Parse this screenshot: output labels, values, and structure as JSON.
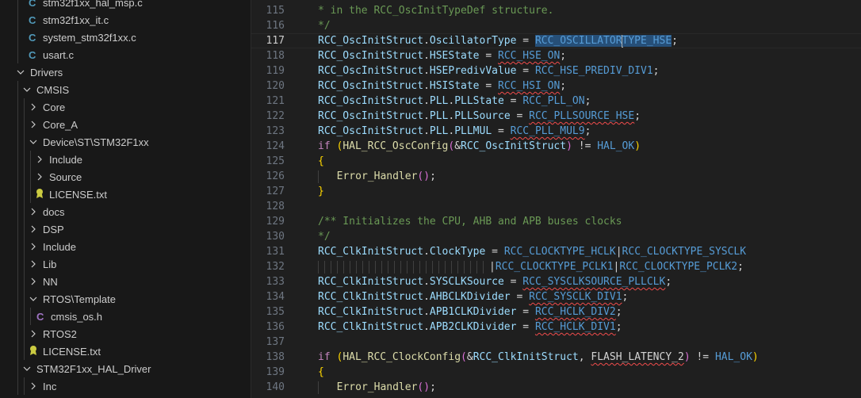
{
  "explorer": {
    "items": [
      {
        "label": "stm32f1xx_hal_msp.c",
        "type": "c-file"
      },
      {
        "label": "stm32f1xx_it.c",
        "type": "c-file"
      },
      {
        "label": "system_stm32f1xx.c",
        "type": "c-file"
      },
      {
        "label": "usart.c",
        "type": "c-file"
      },
      {
        "label": "Drivers",
        "type": "folder-open"
      },
      {
        "label": "CMSIS",
        "type": "folder-open"
      },
      {
        "label": "Core",
        "type": "folder"
      },
      {
        "label": "Core_A",
        "type": "folder"
      },
      {
        "label": "Device\\ST\\STM32F1xx",
        "type": "folder-open"
      },
      {
        "label": "Include",
        "type": "folder"
      },
      {
        "label": "Source",
        "type": "folder"
      },
      {
        "label": "LICENSE.txt",
        "type": "license-file"
      },
      {
        "label": "docs",
        "type": "folder"
      },
      {
        "label": "DSP",
        "type": "folder"
      },
      {
        "label": "Include",
        "type": "folder"
      },
      {
        "label": "Lib",
        "type": "folder"
      },
      {
        "label": "NN",
        "type": "folder"
      },
      {
        "label": "RTOS\\Template",
        "type": "folder-open"
      },
      {
        "label": "cmsis_os.h",
        "type": "c-file"
      },
      {
        "label": "RTOS2",
        "type": "folder"
      },
      {
        "label": "LICENSE.txt",
        "type": "license-file"
      },
      {
        "label": "STM32F1xx_HAL_Driver",
        "type": "folder-open"
      },
      {
        "label": "Inc",
        "type": "folder"
      }
    ]
  },
  "editor": {
    "active_line": "117",
    "line_numbers": [
      "115",
      "116",
      "117",
      "118",
      "119",
      "120",
      "121",
      "122",
      "123",
      "124",
      "125",
      "126",
      "127",
      "128",
      "129",
      "130",
      "131",
      "132",
      "133",
      "134",
      "135",
      "136",
      "137",
      "138",
      "139",
      "140"
    ],
    "code": {
      "l115": "* in the RCC_OscInitTypeDef structure.",
      "l116": "*/",
      "l117_a": "RCC_OscInitStruct",
      "l117_b": "OscillatorType",
      "l117_c": "RCC_OSCILLATOR",
      "l117_d": "TYPE_HSE",
      "l118_a": "RCC_OscInitStruct",
      "l118_b": "HSEState",
      "l118_c": "RCC_HSE_ON",
      "l119_a": "RCC_OscInitStruct",
      "l119_b": "HSEPredivValue",
      "l119_c": "RCC_HSE_PREDIV_DIV1",
      "l120_a": "RCC_OscInitStruct",
      "l120_b": "HSIState",
      "l120_c": "RCC_HSI_ON",
      "l121_a": "RCC_OscInitStruct",
      "l121_b": "PLL",
      "l121_c": "PLLState",
      "l121_d": "RCC_PLL_ON",
      "l122_a": "RCC_OscInitStruct",
      "l122_b": "PLL",
      "l122_c": "PLLSource",
      "l122_d": "RCC_PLLSOURCE_HSE",
      "l123_a": "RCC_OscInitStruct",
      "l123_b": "PLL",
      "l123_c": "PLLMUL",
      "l123_d": "RCC_PLL_MUL9",
      "l124_kw": "if",
      "l124_fn": "HAL_RCC_OscConfig",
      "l124_arg": "RCC_OscInitStruct",
      "l124_ok": "HAL_OK",
      "l126_fn": "Error_Handler",
      "l129": "/** Initializes the CPU, AHB and APB buses clocks",
      "l130": "*/",
      "l131_a": "RCC_ClkInitStruct",
      "l131_b": "ClockType",
      "l131_c": "RCC_CLOCKTYPE_HCLK",
      "l131_d": "RCC_CLOCKTYPE_SYSCLK",
      "l132_a": "RCC_CLOCKTYPE_PCLK1",
      "l132_b": "RCC_CLOCKTYPE_PCLK2",
      "l133_a": "RCC_ClkInitStruct",
      "l133_b": "SYSCLKSource",
      "l133_c": "RCC_SYSCLKSOURCE_PLLCLK",
      "l134_a": "RCC_ClkInitStruct",
      "l134_b": "AHBCLKDivider",
      "l134_c": "RCC_SYSCLK_DIV1",
      "l135_a": "RCC_ClkInitStruct",
      "l135_b": "APB1CLKDivider",
      "l135_c": "RCC_HCLK_DIV2",
      "l136_a": "RCC_ClkInitStruct",
      "l136_b": "APB2CLKDivider",
      "l136_c": "RCC_HCLK_DIV1",
      "l138_kw": "if",
      "l138_fn": "HAL_RCC_ClockConfig",
      "l138_arg": "RCC_ClkInitStruct",
      "l138_lat": "FLASH_LATENCY_2",
      "l138_ok": "HAL_OK",
      "l140_fn": "Error_Handler"
    }
  }
}
